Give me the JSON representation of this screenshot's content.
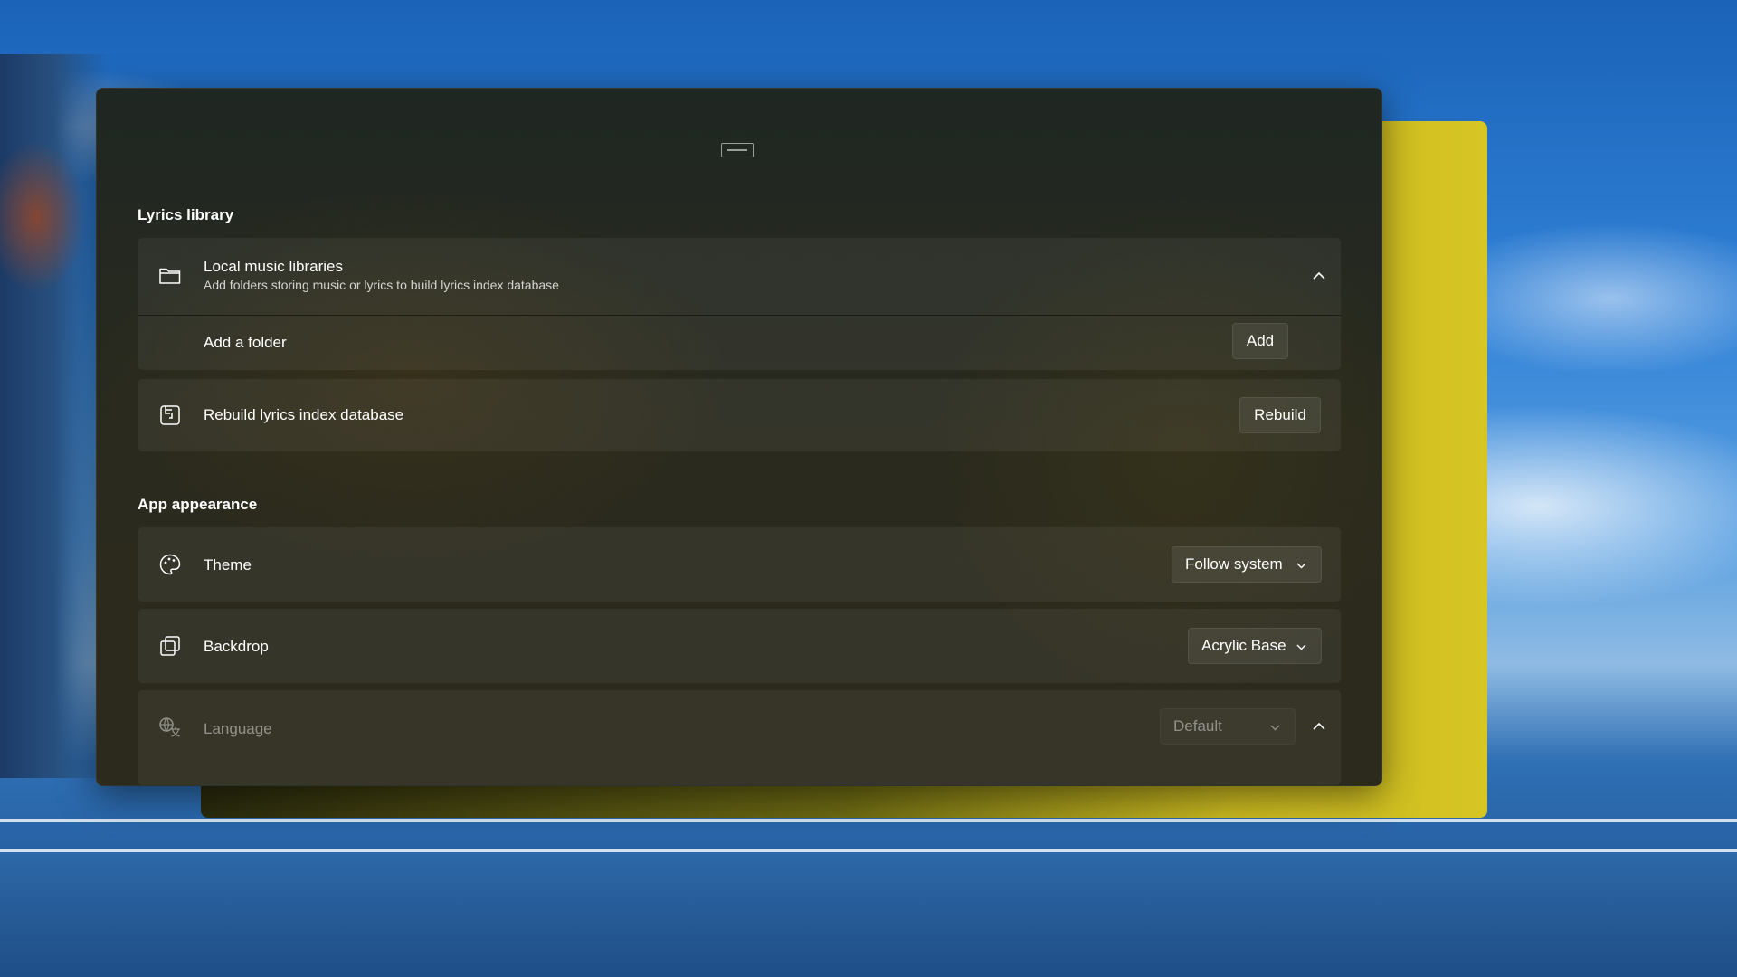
{
  "lyrics_library": {
    "section_title": "Lyrics library",
    "local_music": {
      "title": "Local music libraries",
      "subtitle": "Add folders storing music or lyrics to build lyrics index database",
      "icon": "folder-icon",
      "expanded": true
    },
    "add_folder": {
      "label": "Add a folder",
      "button_label": "Add"
    },
    "rebuild": {
      "title": "Rebuild lyrics index database",
      "button_label": "Rebuild",
      "icon": "database-rebuild-icon"
    }
  },
  "app_appearance": {
    "section_title": "App appearance",
    "theme": {
      "label": "Theme",
      "selected": "Follow system",
      "icon": "palette-icon"
    },
    "backdrop": {
      "label": "Backdrop",
      "selected": "Acrylic Base",
      "icon": "backdrop-icon"
    },
    "language": {
      "label": "Language",
      "selected": "Default",
      "icon": "language-icon",
      "disabled": true
    }
  },
  "colors": {
    "accent_back_window": "#d6c523",
    "card_text": "#ffffff"
  }
}
